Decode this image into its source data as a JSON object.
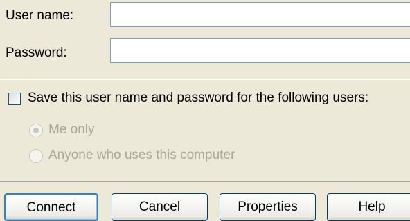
{
  "form": {
    "username_label": "User name:",
    "username_value": "",
    "password_label": "Password:",
    "password_value": ""
  },
  "save_option": {
    "checkbox_label": "Save this user name and password for the following users:",
    "checked": false,
    "radio_me_only": "Me only",
    "radio_anyone": "Anyone who uses this computer",
    "selected": "Me only"
  },
  "buttons": {
    "connect": "Connect",
    "cancel": "Cancel",
    "properties": "Properties",
    "help": "Help"
  }
}
